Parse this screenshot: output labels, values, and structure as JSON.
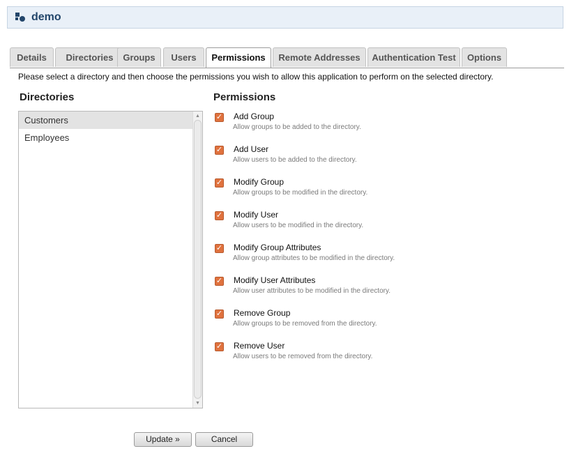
{
  "header": {
    "title": "demo",
    "icon": "atlassian-crowd-icon"
  },
  "tabs": [
    {
      "label": "Details",
      "active": false
    },
    {
      "label": "Directories",
      "active": false
    },
    {
      "label": "Groups",
      "active": false
    },
    {
      "label": "Users",
      "active": false
    },
    {
      "label": "Permissions",
      "active": true
    },
    {
      "label": "Remote Addresses",
      "active": false
    },
    {
      "label": "Authentication Test",
      "active": false
    },
    {
      "label": "Options",
      "active": false
    }
  ],
  "instructions": "Please select a directory and then choose the permissions you wish to allow this application to perform on the selected directory.",
  "directories": {
    "heading": "Directories",
    "items": [
      {
        "label": "Customers",
        "selected": true
      },
      {
        "label": "Employees",
        "selected": false
      }
    ]
  },
  "permissions": {
    "heading": "Permissions",
    "checkbox_color": "#e0723e",
    "items": [
      {
        "label": "Add Group",
        "description": "Allow groups to be added to the directory.",
        "checked": true
      },
      {
        "label": "Add User",
        "description": "Allow users to be added to the directory.",
        "checked": true
      },
      {
        "label": "Modify Group",
        "description": "Allow groups to be modified in the directory.",
        "checked": true
      },
      {
        "label": "Modify User",
        "description": "Allow users to be modified in the directory.",
        "checked": true
      },
      {
        "label": "Modify Group Attributes",
        "description": "Allow group attributes to be modified in the directory.",
        "checked": true
      },
      {
        "label": "Modify User Attributes",
        "description": "Allow user attributes to be modified in the directory.",
        "checked": true
      },
      {
        "label": "Remove Group",
        "description": "Allow groups to be removed from the directory.",
        "checked": true
      },
      {
        "label": "Remove User",
        "description": "Allow users to be removed from the directory.",
        "checked": true
      }
    ]
  },
  "buttons": {
    "update": "Update »",
    "cancel": "Cancel"
  }
}
